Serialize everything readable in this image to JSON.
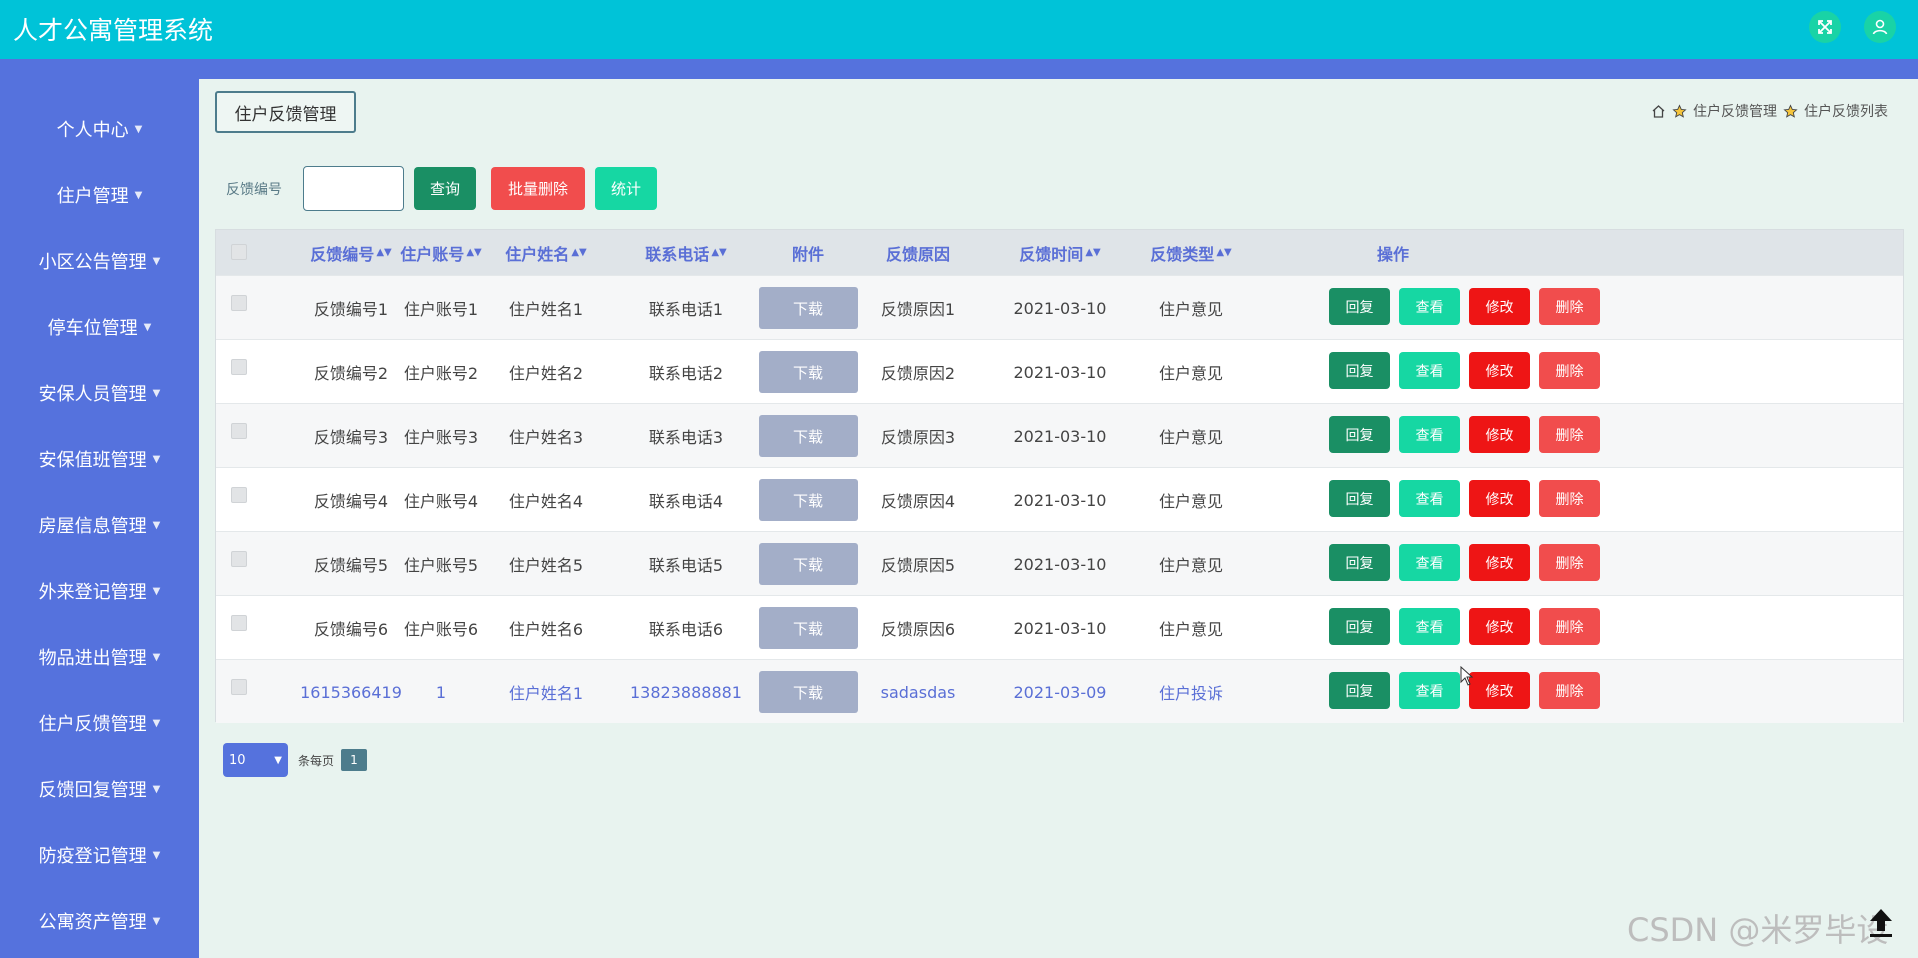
{
  "app": {
    "title": "人才公寓管理系统"
  },
  "sidebar": {
    "items": [
      {
        "label": "个人中心"
      },
      {
        "label": "住户管理"
      },
      {
        "label": "小区公告管理"
      },
      {
        "label": "停车位管理"
      },
      {
        "label": "安保人员管理"
      },
      {
        "label": "安保值班管理"
      },
      {
        "label": "房屋信息管理"
      },
      {
        "label": "外来登记管理"
      },
      {
        "label": "物品进出管理"
      },
      {
        "label": "住户反馈管理"
      },
      {
        "label": "反馈回复管理"
      },
      {
        "label": "防疫登记管理"
      },
      {
        "label": "公寓资产管理"
      }
    ]
  },
  "page": {
    "tag": "住户反馈管理",
    "breadcrumb": [
      "住户反馈管理",
      "住户反馈列表"
    ]
  },
  "search": {
    "label": "反馈编号",
    "value": "",
    "query_label": "查询",
    "batch_delete_label": "批量删除",
    "stats_label": "统计"
  },
  "table": {
    "headers": {
      "id": "反馈编号",
      "account": "住户账号",
      "name": "住户姓名",
      "phone": "联系电话",
      "attachment": "附件",
      "reason": "反馈原因",
      "time": "反馈时间",
      "type": "反馈类型",
      "ops": "操作"
    },
    "download_label": "下载",
    "actions": {
      "reply": "回复",
      "view": "查看",
      "edit": "修改",
      "delete": "删除"
    },
    "rows": [
      {
        "id": "反馈编号1",
        "account": "住户账号1",
        "name": "住户姓名1",
        "phone": "联系电话1",
        "reason": "反馈原因1",
        "time": "2021-03-10",
        "type": "住户意见"
      },
      {
        "id": "反馈编号2",
        "account": "住户账号2",
        "name": "住户姓名2",
        "phone": "联系电话2",
        "reason": "反馈原因2",
        "time": "2021-03-10",
        "type": "住户意见"
      },
      {
        "id": "反馈编号3",
        "account": "住户账号3",
        "name": "住户姓名3",
        "phone": "联系电话3",
        "reason": "反馈原因3",
        "time": "2021-03-10",
        "type": "住户意见"
      },
      {
        "id": "反馈编号4",
        "account": "住户账号4",
        "name": "住户姓名4",
        "phone": "联系电话4",
        "reason": "反馈原因4",
        "time": "2021-03-10",
        "type": "住户意见"
      },
      {
        "id": "反馈编号5",
        "account": "住户账号5",
        "name": "住户姓名5",
        "phone": "联系电话5",
        "reason": "反馈原因5",
        "time": "2021-03-10",
        "type": "住户意见"
      },
      {
        "id": "反馈编号6",
        "account": "住户账号6",
        "name": "住户姓名6",
        "phone": "联系电话6",
        "reason": "反馈原因6",
        "time": "2021-03-10",
        "type": "住户意见"
      },
      {
        "id": "1615366419",
        "account": "1",
        "name": "住户姓名1",
        "phone": "13823888881",
        "reason": "sadasdas",
        "time": "2021-03-09",
        "type": "住户投诉"
      }
    ]
  },
  "pager": {
    "page_size": "10",
    "per_page_label": "条每页",
    "current_page": "1"
  },
  "watermark": "CSDN @米罗毕设",
  "colors": {
    "topbar": "#00c3d8",
    "sidebar": "#5572dd",
    "header_text": "#5a6fd6",
    "reply": "#1a8f64",
    "view": "#16d7a3",
    "edit": "#ee1515",
    "delete": "#f14d4d"
  }
}
